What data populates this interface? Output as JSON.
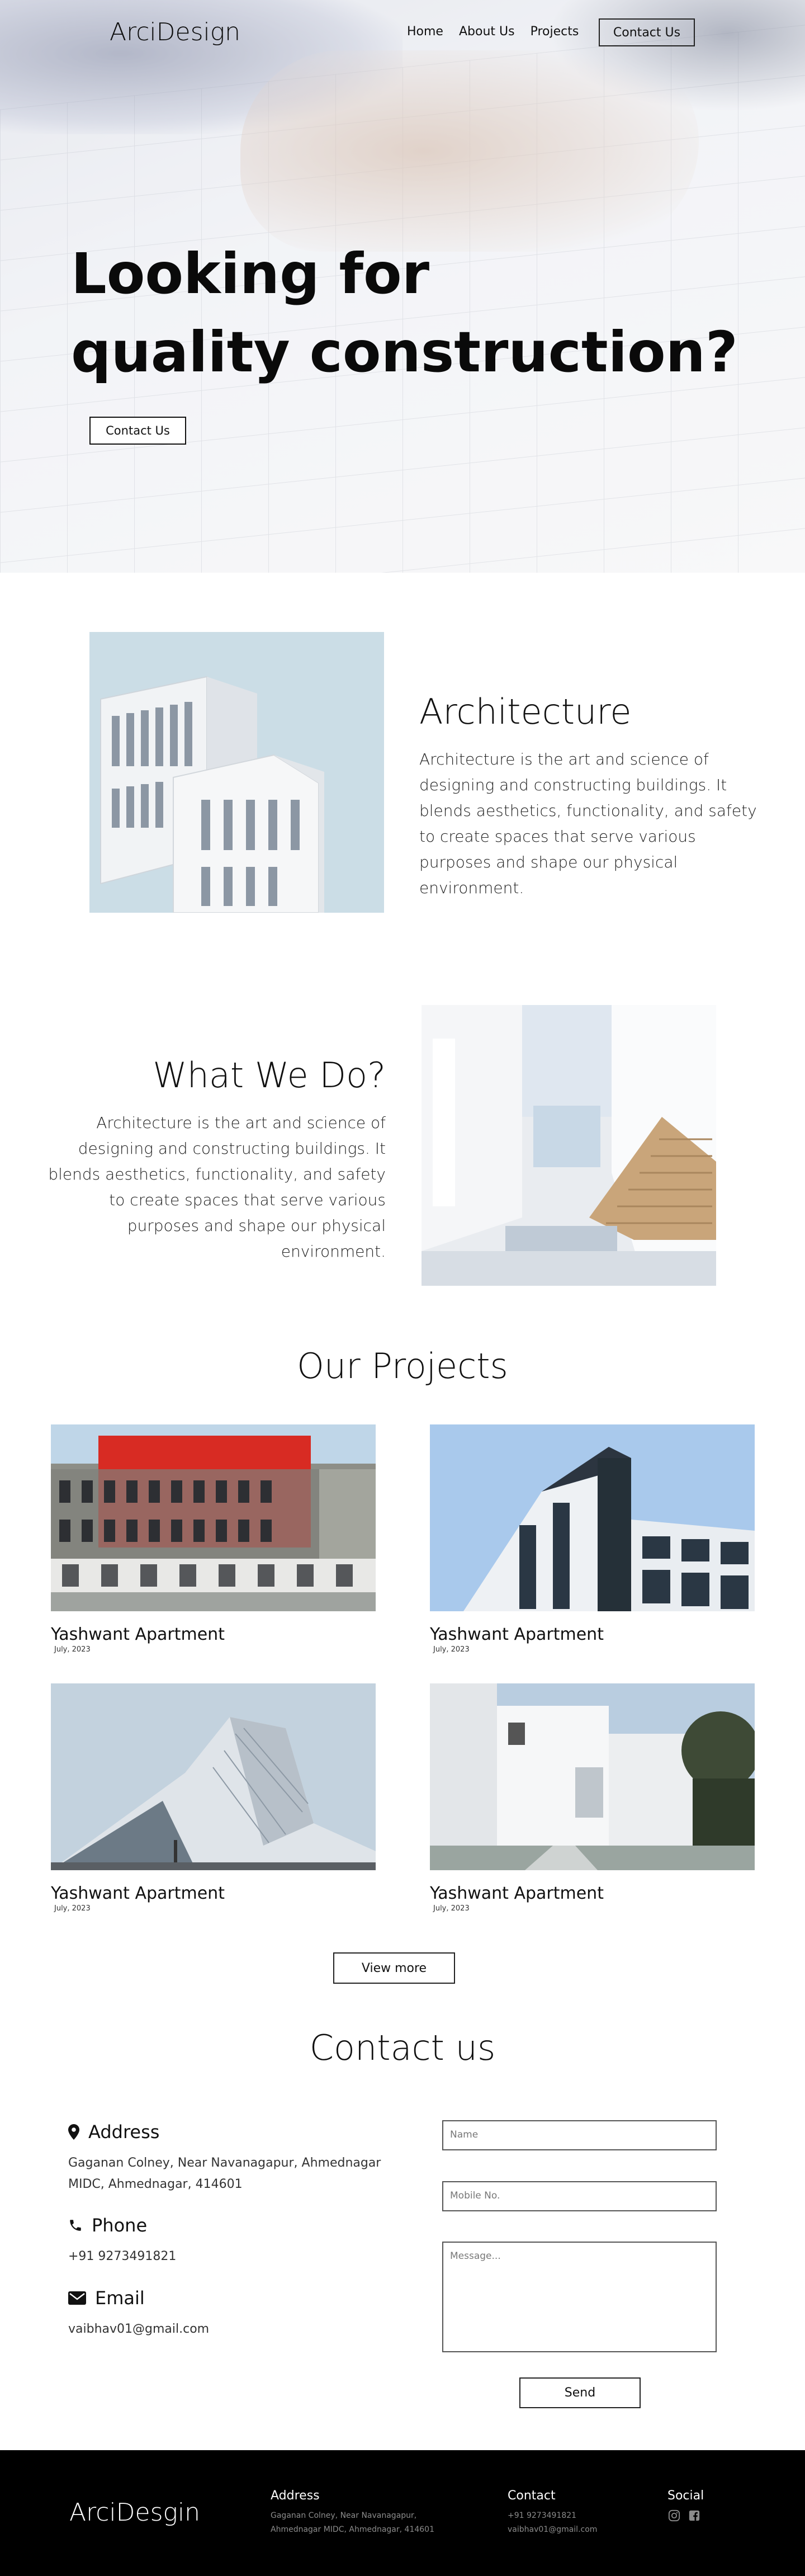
{
  "nav": {
    "logo": "ArciDesign",
    "links": [
      "Home",
      "About Us",
      "Projects"
    ],
    "cta": "Contact Us"
  },
  "hero": {
    "title_line1": "Looking for",
    "title_line2": "quality construction?",
    "button": "Contact Us"
  },
  "architecture": {
    "title": "Architecture",
    "text": "Architecture is the art and science of designing and constructing buildings. It blends aesthetics, functionality, and safety to create spaces that serve various purposes and shape our physical environment."
  },
  "what_we_do": {
    "title": "What We Do?",
    "text": "Architecture is the art and science of designing and constructing buildings. It blends aesthetics, functionality, and safety to create spaces that serve various purposes and shape our physical environment."
  },
  "projects": {
    "title": "Our Projects",
    "items": [
      {
        "name": "Yashwant Apartment",
        "date": "July, 2023"
      },
      {
        "name": "Yashwant Apartment",
        "date": "July, 2023"
      },
      {
        "name": "Yashwant Apartment",
        "date": "July, 2023"
      },
      {
        "name": "Yashwant Apartment",
        "date": "July, 2023"
      }
    ],
    "view_more": "View more"
  },
  "contact": {
    "title": "Contact us",
    "address_label": "Address",
    "address_text": "Gaganan Colney, Near Navanagapur, Ahmednagar MIDC, Ahmednagar, 414601",
    "phone_label": "Phone",
    "phone_text": "+91 9273491821",
    "email_label": "Email",
    "email_text": "vaibhav01@gmail.com",
    "form": {
      "name_placeholder": "Name",
      "mobile_placeholder": "Mobile No.",
      "message_placeholder": "Message...",
      "send": "Send"
    }
  },
  "footer": {
    "logo": "ArciDesgin",
    "address_head": "Address",
    "address_line1": "Gaganan Colney, Near Navanagapur,",
    "address_line2": "Ahmednagar MIDC, Ahmednagar, 414601",
    "contact_head": "Contact",
    "contact_phone": "+91 9273491821",
    "contact_email": "vaibhav01@gmail.com",
    "social_head": "Social",
    "social_icons": [
      "instagram-icon",
      "facebook-icon"
    ]
  }
}
